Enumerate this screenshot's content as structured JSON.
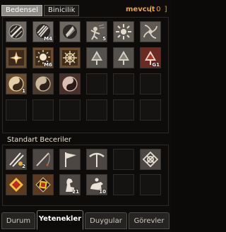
{
  "header": {
    "tab_bedensel": "Bedensel",
    "tab_binicilik": "Binicilik",
    "mevcut_label": "mevcut",
    "points_value": "[ 0 ]"
  },
  "skills_top": [
    {
      "name": "skill-3way-cut",
      "level": ""
    },
    {
      "name": "skill-sword-spin",
      "level": "M4"
    },
    {
      "name": "skill-aura",
      "level": ""
    },
    {
      "name": "skill-dash",
      "level": "5"
    },
    {
      "name": "skill-berserk",
      "level": ""
    },
    {
      "name": "skill-fear",
      "level": ""
    },
    {
      "name": "skill-bash",
      "level": ""
    },
    {
      "name": "skill-sunburst",
      "level": "M6"
    },
    {
      "name": "skill-crossburst",
      "level": ""
    },
    {
      "name": "skill-tree-passive-1",
      "level": ""
    },
    {
      "name": "skill-tree-passive-2",
      "level": ""
    },
    {
      "name": "skill-tree-passive-3",
      "level": "G1"
    },
    {
      "name": "skill-yin-yang-1",
      "level": "1"
    },
    {
      "name": "skill-yin-yang-2",
      "level": ""
    },
    {
      "name": "skill-yin-yang-3",
      "level": ""
    }
  ],
  "standard": {
    "title": "Standart Beceriler",
    "items": [
      {
        "name": "skill-combo",
        "level": "2"
      },
      {
        "name": "skill-fishing",
        "level": ""
      },
      {
        "name": "skill-flag",
        "level": ""
      },
      {
        "name": "skill-mining",
        "level": ""
      },
      {
        "name": "skill-empty-1",
        "level": ""
      },
      {
        "name": "skill-knot",
        "level": ""
      },
      {
        "name": "skill-red-gem",
        "level": ""
      },
      {
        "name": "skill-book",
        "level": ""
      },
      {
        "name": "skill-horse",
        "level": "21"
      },
      {
        "name": "skill-horse-ride",
        "level": "10"
      }
    ]
  },
  "bottom_tabs": {
    "durum": "Durum",
    "yetenekler": "Yetenekler",
    "duygular": "Duygular",
    "gorevler": "Görevler"
  },
  "colors": {
    "accent": "#f2a03a",
    "active_tab": "#8f8d88"
  }
}
